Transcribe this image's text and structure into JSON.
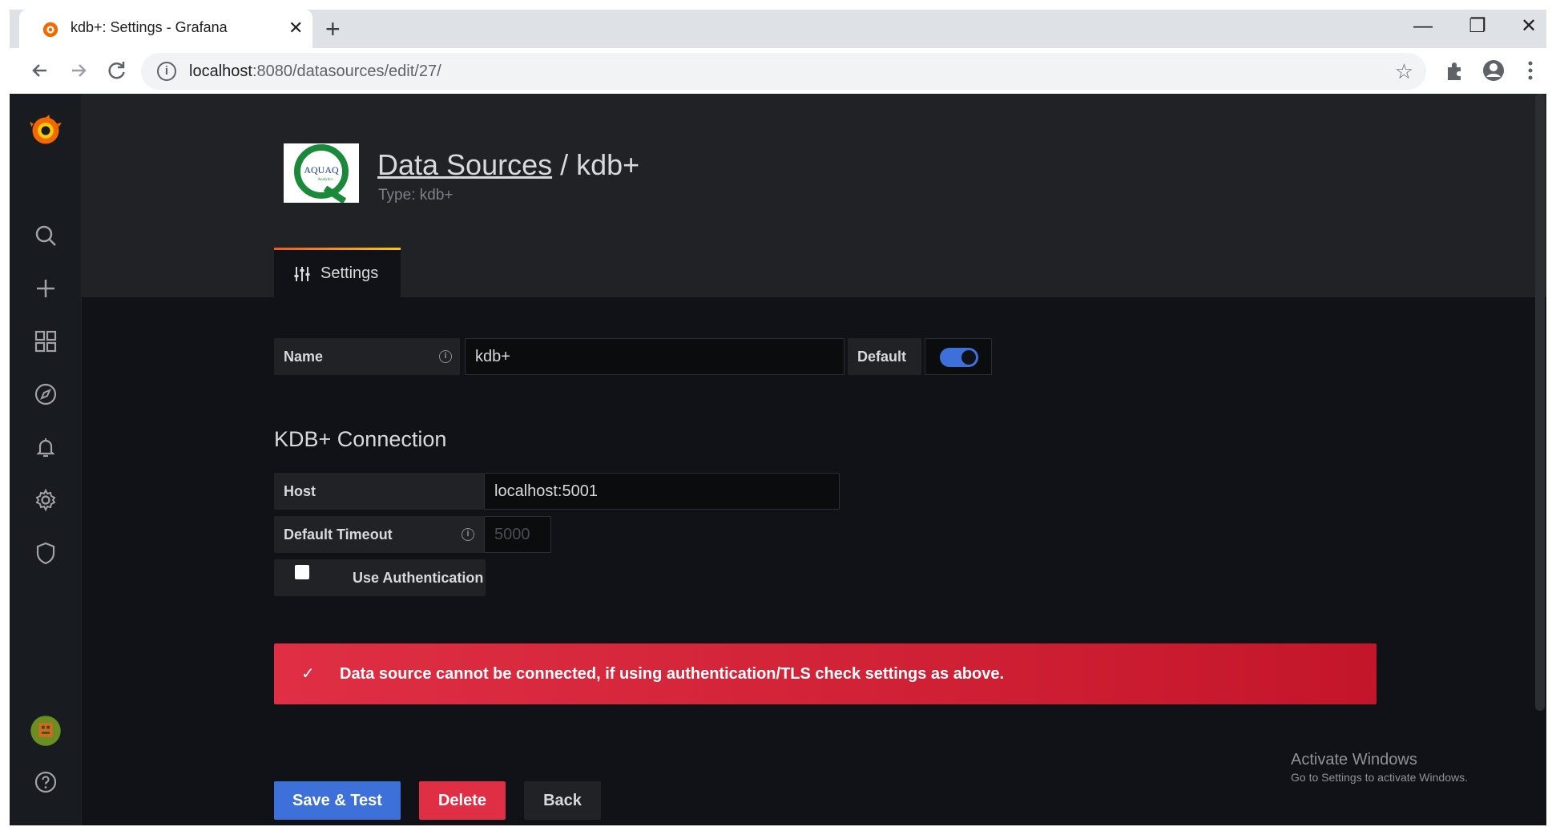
{
  "browser": {
    "tab_title": "kdb+: Settings - Grafana",
    "tab_close": "✕",
    "new_tab": "+",
    "url_host": "localhost",
    "url_rest": ":8080/datasources/edit/27/",
    "window_minimize": "—",
    "window_restore": "❐",
    "window_close": "✕"
  },
  "header": {
    "breadcrumb_link": "Data Sources",
    "separator": " / ",
    "title": "kdb+",
    "subtitle": "Type: kdb+",
    "logo_text": "AQUAQ",
    "logo_subtext": "Analytics"
  },
  "tabs": [
    {
      "label": "Settings",
      "active": true
    }
  ],
  "form": {
    "name_label": "Name",
    "name_value": "kdb+",
    "default_label": "Default",
    "default_on": true,
    "section_title": "KDB+ Connection",
    "host_label": "Host",
    "host_value": "localhost:5001",
    "timeout_label": "Default Timeout",
    "timeout_placeholder": "5000",
    "auth_label": "Use Authentication",
    "auth_checked": false
  },
  "alert": {
    "icon": "✓",
    "message": "Data source cannot be connected, if using authentication/TLS check settings as above."
  },
  "buttons": {
    "save": "Save & Test",
    "delete": "Delete",
    "back": "Back"
  },
  "watermark": {
    "line1": "Activate Windows",
    "line2": "Go to Settings to activate Windows."
  },
  "colors": {
    "primary": "#3d71d9",
    "danger": "#e02f44",
    "background": "#111217",
    "panel": "#202226",
    "grafana_orange": "#f05a28"
  },
  "sidebar_icons": [
    "grafana-logo-icon",
    "search-icon",
    "plus-icon",
    "dashboards-icon",
    "explore-compass-icon",
    "alerting-bell-icon",
    "configuration-gear-icon",
    "server-admin-shield-icon",
    "user-avatar",
    "help-icon"
  ]
}
